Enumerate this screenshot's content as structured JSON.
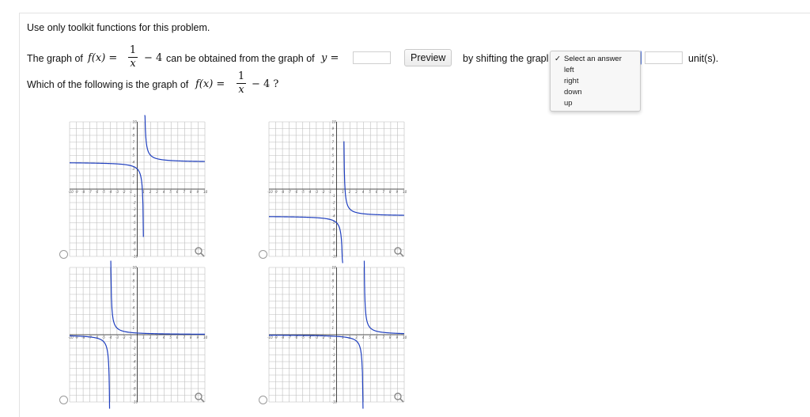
{
  "instruction": "Use only toolkit functions for this problem.",
  "question1": {
    "prefix": "The graph of",
    "f_of_x": "f(x) =",
    "frac_num": "1",
    "frac_den": "x",
    "tail": "− 4",
    "middle": "can be obtained from the graph of",
    "y_eq": "y =",
    "answer_value": "",
    "preview_label": "Preview",
    "shift_text": "by shifting the grapl",
    "amount_value": "",
    "units_text": "unit(s)."
  },
  "direction_select": {
    "options": [
      "Select an answer",
      "left",
      "right",
      "down",
      "up"
    ],
    "selected": "Select an answer",
    "check_mark": "✓"
  },
  "question2": {
    "prefix": "Which of the following is the graph of",
    "f_of_x": "f(x) =",
    "frac_num": "1",
    "frac_den": "x",
    "tail": "− 4 ?"
  },
  "graph_axis": {
    "x_ticks": [
      "-10",
      "-9",
      "-8",
      "-7",
      "-6",
      "-5",
      "-4",
      "-3",
      "-2",
      "-1",
      "1",
      "2",
      "3",
      "4",
      "5",
      "6",
      "7",
      "8",
      "9",
      "10"
    ],
    "range": [
      -10,
      10
    ]
  },
  "choices": [
    {
      "name": "choice-a",
      "vertical_asymptote": 1,
      "horizontal_asymptote": 4,
      "color": "#1f3fbf"
    },
    {
      "name": "choice-b",
      "vertical_asymptote": 1,
      "horizontal_asymptote": -4,
      "color": "#1f3fbf"
    },
    {
      "name": "choice-c",
      "vertical_asymptote": -4,
      "horizontal_asymptote": 0,
      "color": "#1f3fbf"
    },
    {
      "name": "choice-d",
      "vertical_asymptote": 4,
      "horizontal_asymptote": 0,
      "color": "#1f3fbf"
    }
  ],
  "colors": {
    "curve": "#1f3fbf",
    "grid": "#bdbdbd",
    "axis": "#222222",
    "focus": "#4a6fd8"
  }
}
